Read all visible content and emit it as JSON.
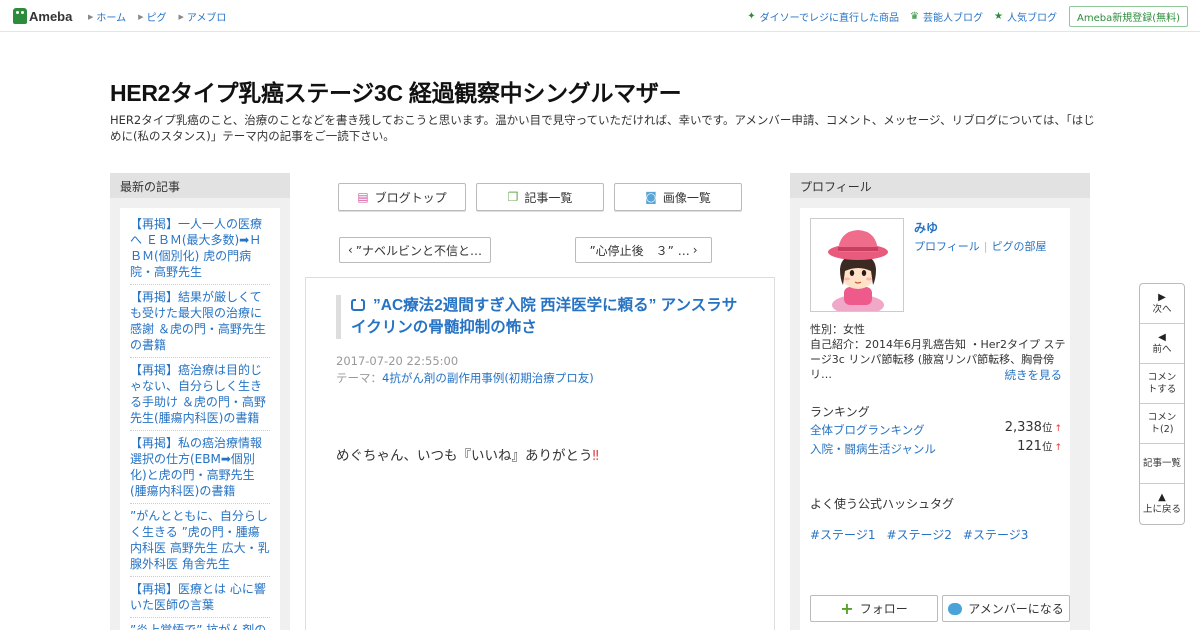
{
  "header": {
    "logo_text": "Ameba",
    "nav": [
      "ホーム",
      "ピグ",
      "アメブロ"
    ],
    "right_links": [
      {
        "label": "ダイソーでレジに直行した商品",
        "icon": "sparkle-icon"
      },
      {
        "label": "芸能人ブログ",
        "icon": "crown-icon"
      },
      {
        "label": "人気ブログ",
        "icon": "star-icon"
      }
    ],
    "register_label": "Ameba新規登録(無料)"
  },
  "blog": {
    "title": "HER2タイプ乳癌ステージ3C 経過観察中シングルマザー",
    "description": "HER2タイプ乳癌のこと、治療のことなどを書き残しておこうと思います。温かい目で見守っていただければ、幸いです。アメンバー申請、コメント、メッセージ、リブログについては、「はじめに(私のスタンス)」テーマ内の記事をご一読下さい。"
  },
  "left": {
    "heading": "最新の記事",
    "items": [
      "【再掲】一人一人の医療へ ＥＢＭ(最大多数)➡ＨＢＭ(個別化) 虎の門病院・高野先生",
      "【再掲】結果が厳しくても受けた最大限の治療に感謝 ＆虎の門・高野先生の書籍",
      "【再掲】癌治療は目的じゃない、自分らしく生きる手助け ＆虎の門・高野先生(腫瘍内科医)の書籍",
      "【再掲】私の癌治療情報選択の仕方(EBM➡個別化)と虎の門・高野先生(腫瘍内科医)の書籍",
      "”がんとともに、自分らしく生きる ”虎の門・腫瘍内科医 高野先生 広大・乳腺外科医 角舎先生",
      "【再掲】医療とは 心に響いた医師の言葉",
      "”炎上覚悟で” 抗がん剤の"
    ]
  },
  "center": {
    "buttons": [
      {
        "label": "ブログトップ",
        "icon": "document-icon"
      },
      {
        "label": "記事一覧",
        "icon": "list-icon"
      },
      {
        "label": "画像一覧",
        "icon": "camera-icon"
      }
    ],
    "prev_label": "”ナベルビンと不信と…",
    "next_label": "”心停止後　３” …",
    "article": {
      "title": "”AC療法2週間すぎ入院 西洋医学に頼る” アンスラサイクリンの骨髄抑制の怖さ",
      "date": "2017-07-20 22:55:00",
      "theme_prefix": "テーマ：",
      "theme": "4抗がん剤の副作用事例(初期治療プロ友)",
      "body": "めぐちゃん、いつも『いいね』ありがとう"
    }
  },
  "profile": {
    "heading": "プロフィール",
    "name": "みゆ",
    "link_profile": "プロフィール",
    "link_pigg": "ピグの部屋",
    "gender": "性別：女性",
    "intro": "自己紹介：2014年6月乳癌告知 ・Her2タイプ ステージ3c リンパ節転移 (腋窩リンパ節転移、胸骨傍リ…",
    "more": "続きを見る",
    "ranking_heading": "ランキング",
    "rankings": [
      {
        "label": "全体ブログランキング",
        "value": "2,338",
        "unit": "位",
        "arrow": "↑"
      },
      {
        "label": "入院・闘病生活ジャンル",
        "value": "121",
        "unit": "位",
        "arrow": "↑"
      }
    ],
    "hashtag_heading": "よく使う公式ハッシュタグ",
    "hashtags": [
      "#ステージ1",
      "#ステージ2",
      "#ステージ3"
    ],
    "follow_label": "フォロー",
    "amember_label": "アメンバーになる"
  },
  "sidenav": [
    {
      "label": "次へ",
      "icon": "triangle-right-icon"
    },
    {
      "label": "前へ",
      "icon": "triangle-left-icon"
    },
    {
      "label": "コメントする",
      "icon": ""
    },
    {
      "label": "コメント(2)",
      "icon": ""
    },
    {
      "label": "記事一覧",
      "icon": ""
    },
    {
      "label": "上に戻る",
      "icon": "triangle-up-icon"
    }
  ],
  "colors": {
    "brand": "#2d8c3c",
    "link": "#2673c4",
    "heart": "#e63c3c"
  }
}
